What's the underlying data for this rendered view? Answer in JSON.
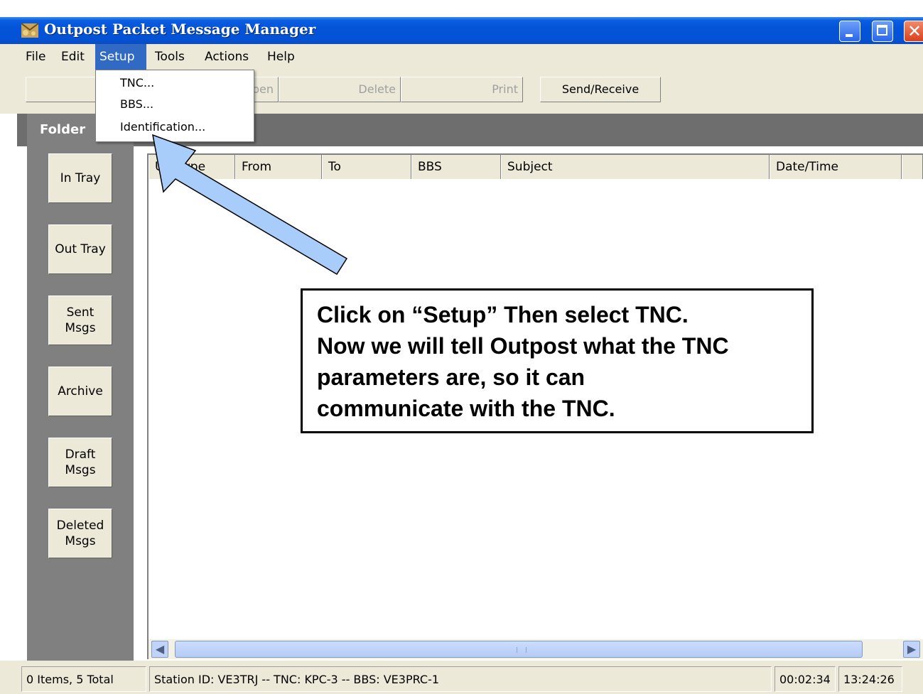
{
  "window": {
    "title": "Outpost Packet Message Manager",
    "controls": [
      "minimize",
      "maximize",
      "close"
    ]
  },
  "menu": {
    "items": [
      "File",
      "Edit",
      "Setup",
      "Tools",
      "Actions",
      "Help"
    ],
    "active": "Setup"
  },
  "setup_menu": {
    "items": [
      "TNC...",
      "BBS...",
      "Identification..."
    ]
  },
  "toolbar": {
    "open_label": "Open",
    "delete_label": "Delete",
    "print_label": "Print",
    "send_receive_label": "Send/Receive"
  },
  "folders": {
    "label": "Folder",
    "items": [
      "In Tray",
      "Out Tray",
      "Sent\nMsgs",
      "Archive",
      "Draft\nMsgs",
      "Deleted\nMsgs"
    ]
  },
  "message_list": {
    "columns": [
      "U",
      "Type",
      "From",
      "To",
      "BBS",
      "Subject",
      "Date/Time"
    ]
  },
  "status": {
    "count": "0 Items, 5 Total",
    "station": "Station ID: VE3TRJ  --  TNC: KPC-3  --  BBS: VE3PRC-1",
    "elapsed": "00:02:34",
    "clock": "13:24:26"
  },
  "callout": {
    "text": "Click on “Setup” Then select TNC.\nNow we will tell Outpost what the TNC\nparameters are, so it can\ncommunicate with the TNC."
  },
  "colors": {
    "titlebar": "#0453d8",
    "menu_highlight": "#316ac5",
    "arrow_fill": "#a9cdfa",
    "panel_grey": "#808080"
  }
}
